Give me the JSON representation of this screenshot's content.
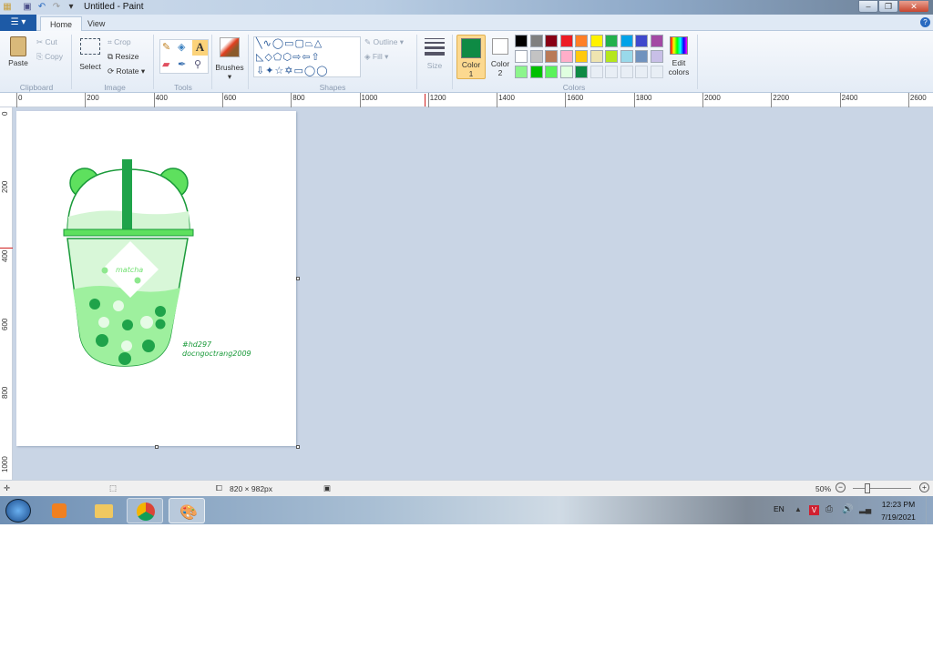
{
  "window": {
    "title": "Untitled - Paint",
    "min": "–",
    "max": "❐",
    "close": "✕"
  },
  "tabs": [
    {
      "label": "Home"
    },
    {
      "label": "View"
    }
  ],
  "ribbon": {
    "clipboard": {
      "label": "Clipboard",
      "paste": "Paste",
      "cut": "Cut",
      "copy": "Copy"
    },
    "image": {
      "label": "Image",
      "select": "Select",
      "crop": "Crop",
      "resize": "Resize",
      "rotate": "Rotate"
    },
    "tools": {
      "label": "Tools"
    },
    "brushes": {
      "label": "Brushes"
    },
    "shapes": {
      "label": "Shapes",
      "outline": "Outline",
      "fill": "Fill"
    },
    "size": {
      "label": "Size"
    },
    "colors": {
      "label": "Colors",
      "color1": "Color 1",
      "color2": "Color 2",
      "edit": "Edit colors",
      "color1_value": "#0e8a44",
      "color2_value": "#ffffff",
      "palette": [
        "#000000",
        "#7f7f7f",
        "#880015",
        "#ed1c24",
        "#ff7f27",
        "#fff200",
        "#22b14c",
        "#00a2e8",
        "#3f48cc",
        "#a349a4",
        "#ffffff",
        "#c3c3c3",
        "#b97a57",
        "#ffaec9",
        "#ffc90e",
        "#efe4b0",
        "#b5e61d",
        "#99d9ea",
        "#7092be",
        "#c8bfe7",
        "#8cf58c",
        "#00c000",
        "#5af25a",
        "#e0ffe0",
        "#0e8a44",
        "",
        "",
        "",
        "",
        ""
      ]
    }
  },
  "ruler": {
    "h": [
      "0",
      "200",
      "400",
      "600",
      "800",
      "1000",
      "1200",
      "1400",
      "1600",
      "1800",
      "2000",
      "2200",
      "2400",
      "2600"
    ],
    "v": [
      "0",
      "200",
      "400",
      "600",
      "800",
      "1000"
    ]
  },
  "drawing": {
    "label": "matcha",
    "tag1": "#hd297",
    "tag2": "docngoctrang2009"
  },
  "status": {
    "size": "820 × 982px",
    "zoom": "50%",
    "zoom_level": 50
  },
  "taskbar": {
    "lang": "EN",
    "time": "12:23 PM",
    "date": "7/19/2021"
  }
}
